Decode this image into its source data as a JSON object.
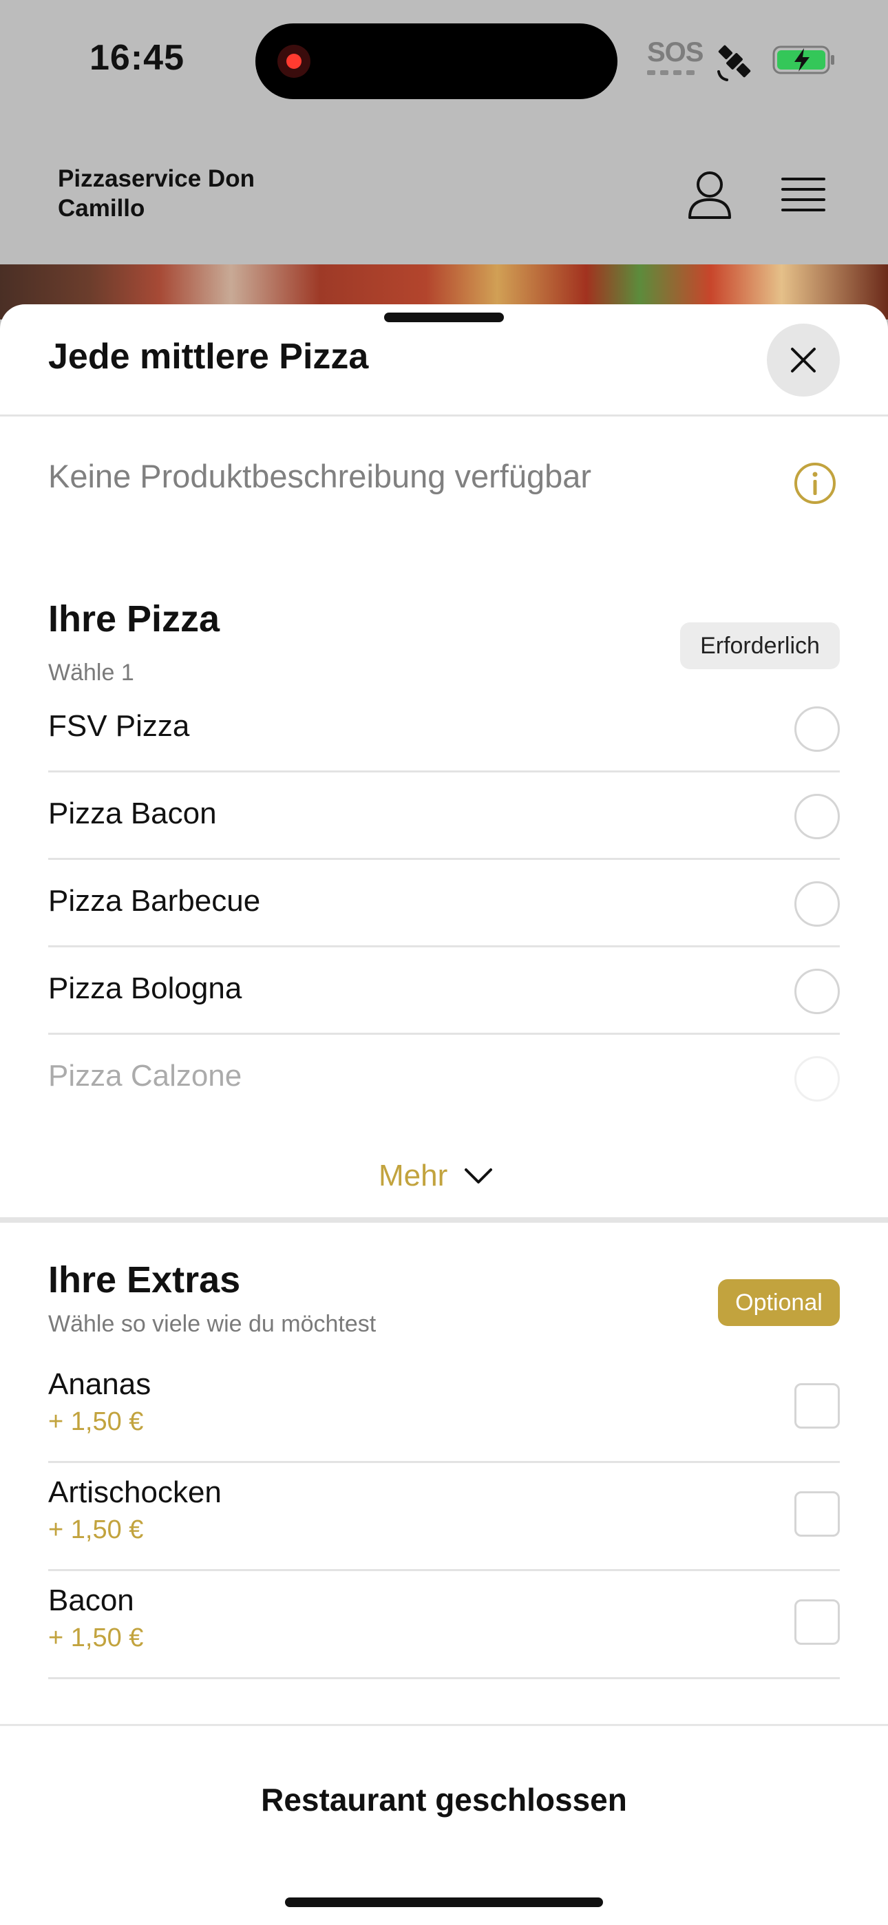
{
  "status_bar": {
    "time": "16:45",
    "sos_label": "SOS",
    "icons": [
      "record-indicator-icon",
      "satellite-icon",
      "battery-charging-icon"
    ]
  },
  "header": {
    "brand": "Pizzaservice Don Camillo",
    "icons": [
      "user-icon",
      "menu-icon"
    ]
  },
  "sheet": {
    "title": "Jede mittlere Pizza",
    "description": "Keine Produktbeschreibung verfügbar",
    "pizza_section": {
      "title": "Ihre Pizza",
      "subtitle": "Wähle 1",
      "badge": "Erforderlich",
      "options": [
        {
          "label": "FSV Pizza"
        },
        {
          "label": "Pizza Bacon"
        },
        {
          "label": "Pizza Barbecue"
        },
        {
          "label": "Pizza Bologna"
        },
        {
          "label": "Pizza Calzone"
        }
      ],
      "more_label": "Mehr"
    },
    "extras_section": {
      "title": "Ihre Extras",
      "subtitle": "Wähle so viele wie du möchtest",
      "badge": "Optional",
      "items": [
        {
          "label": "Ananas",
          "price": "+ 1,50 €"
        },
        {
          "label": "Artischocken",
          "price": "+ 1,50 €"
        },
        {
          "label": "Bacon",
          "price": "+ 1,50 €"
        }
      ]
    },
    "footer_button": "Restaurant geschlossen"
  },
  "colors": {
    "accent": "#c2a33e",
    "dimmed_background": "#bcbcbc",
    "recording_dot": "#ff3b30",
    "battery_fill": "#34c759"
  }
}
